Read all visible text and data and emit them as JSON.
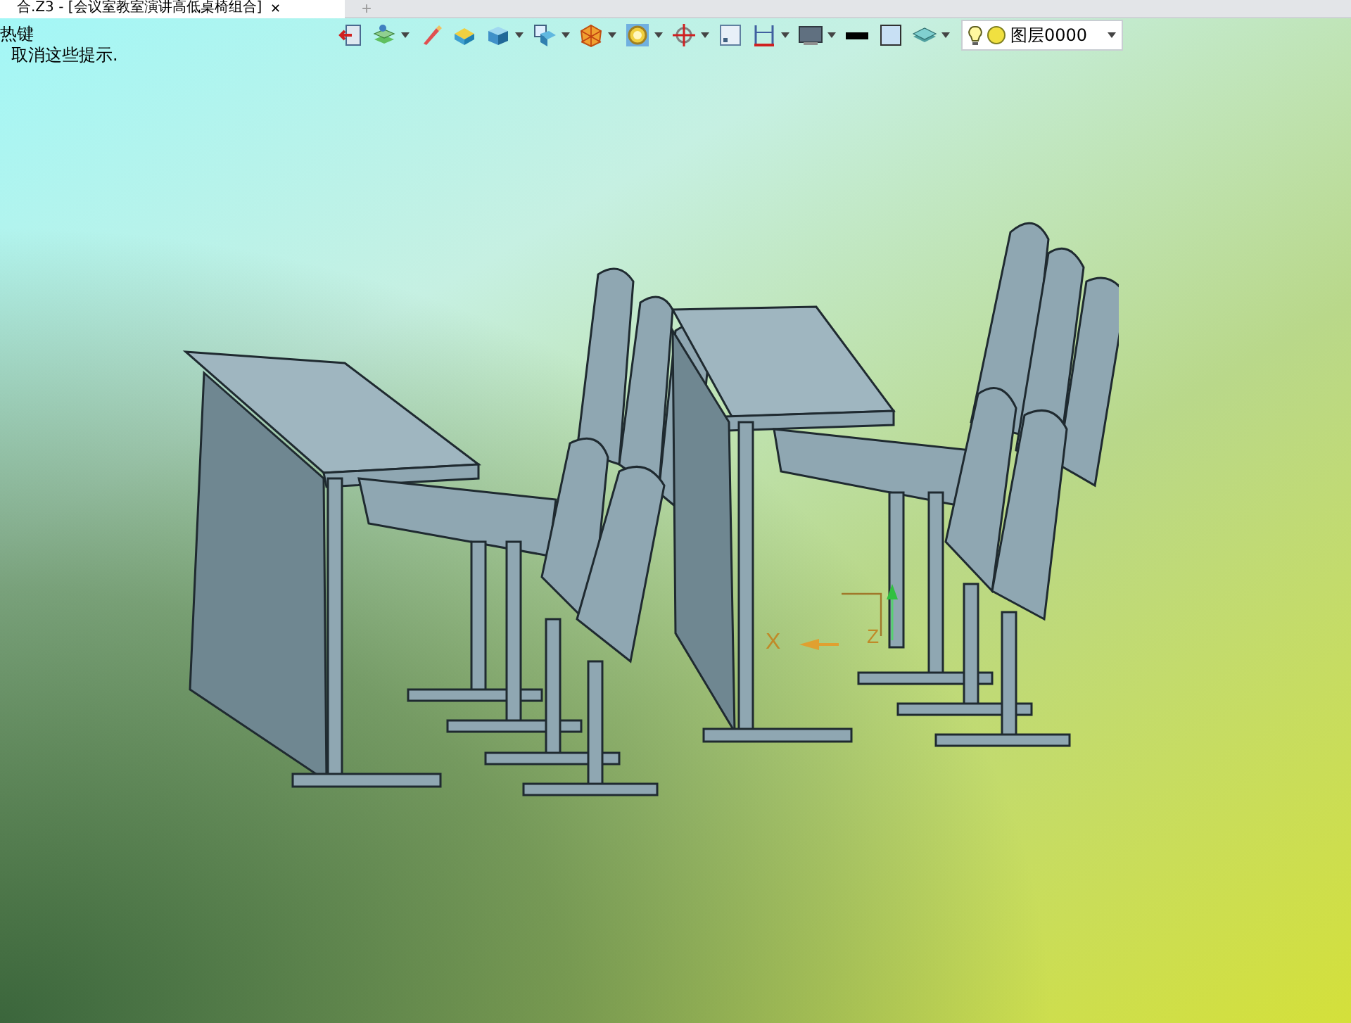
{
  "tab": {
    "title": "合.Z3 - [会议室教室演讲高低桌椅组合]",
    "close": "✕",
    "new_tab": "+"
  },
  "hints": [
    "热键",
    "取消这些提示."
  ],
  "toolbar": [
    {
      "kind": "exit",
      "menu": false
    },
    {
      "kind": "layers",
      "menu": true
    },
    {
      "kind": "pencil",
      "menu": false
    },
    {
      "kind": "plane",
      "menu": false
    },
    {
      "kind": "cube",
      "menu": true
    },
    {
      "kind": "view",
      "menu": true
    },
    {
      "kind": "shape",
      "menu": true
    },
    {
      "kind": "ring",
      "menu": true
    },
    {
      "kind": "target",
      "menu": true
    },
    {
      "kind": "frame",
      "menu": false
    },
    {
      "kind": "dimension",
      "menu": true
    },
    {
      "kind": "screen",
      "menu": true
    },
    {
      "kind": "line",
      "menu": false
    },
    {
      "kind": "square",
      "menu": false
    },
    {
      "kind": "stack",
      "menu": true
    }
  ],
  "layer_combo": {
    "value": "图层0000"
  },
  "triad": {
    "x_label": "X",
    "z_label": "Z"
  }
}
